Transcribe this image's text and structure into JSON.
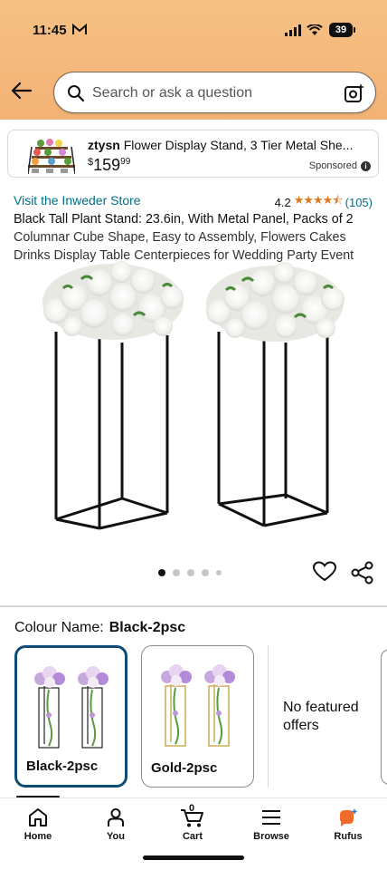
{
  "status": {
    "time": "11:45",
    "battery": "39"
  },
  "search": {
    "placeholder": "Search or ask a question"
  },
  "sponsored": {
    "brand": "ztysn",
    "title": "Flower Display Stand, 3 Tier Metal She...",
    "price_symbol": "$",
    "price_whole": "159",
    "price_fraction": "99",
    "label": "Sponsored"
  },
  "product": {
    "store_link": "Visit the Inweder Store",
    "rating": "4.2",
    "stars": "★★★★⯪",
    "rating_count": "(105)",
    "title_bold": "Black Tall Plant Stand: 23.6in, With Metal Panel, Packs of 2",
    "title_rest": "Columnar Cube Shape, Easy to Assembly, Flowers Cakes Drinks Display Table Centerpieces for Wedding Party Event",
    "image_dots": 5,
    "active_dot": 0
  },
  "variants": {
    "label": "Colour Name:",
    "selected_value": "Black-2psc",
    "options": [
      {
        "label": "Black-2psc",
        "selected": true
      },
      {
        "label": "Gold-2psc",
        "selected": false
      }
    ],
    "no_offers_text": "No featured offers"
  },
  "nav": {
    "items": [
      {
        "label": "Home",
        "icon": "home-icon"
      },
      {
        "label": "You",
        "icon": "person-icon"
      },
      {
        "label": "Cart",
        "icon": "cart-icon",
        "count": "0"
      },
      {
        "label": "Browse",
        "icon": "menu-icon"
      },
      {
        "label": "Rufus",
        "icon": "rufus-icon"
      }
    ]
  },
  "colors": {
    "header": "#f3b275",
    "link": "#007185",
    "star": "#de7921",
    "selected_border": "#0f4c75"
  }
}
